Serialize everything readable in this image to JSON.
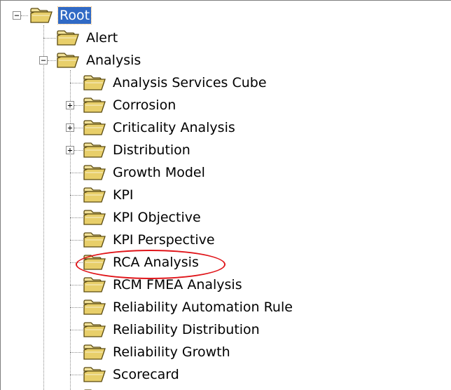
{
  "tree": {
    "nodes": [
      {
        "label": "Root",
        "state": "expanded",
        "selected": true
      },
      {
        "label": "Alert"
      },
      {
        "label": "Analysis",
        "state": "expanded"
      },
      {
        "label": "Analysis Services Cube"
      },
      {
        "label": "Corrosion",
        "state": "collapsed"
      },
      {
        "label": "Criticality Analysis",
        "state": "collapsed"
      },
      {
        "label": "Distribution",
        "state": "collapsed"
      },
      {
        "label": "Growth Model"
      },
      {
        "label": "KPI"
      },
      {
        "label": "KPI Objective"
      },
      {
        "label": "KPI Perspective"
      },
      {
        "label": "RCA Analysis",
        "highlighted": true
      },
      {
        "label": "RCM FMEA Analysis"
      },
      {
        "label": "Reliability Automation Rule"
      },
      {
        "label": "Reliability Distribution"
      },
      {
        "label": "Reliability Growth"
      },
      {
        "label": "Scorecard"
      }
    ],
    "expander_glyphs": {
      "expanded": "−",
      "collapsed": "+"
    },
    "icons": {
      "folder": "folder-icon"
    },
    "colors": {
      "selection": "#316ac5",
      "highlight_ring": "#e0151a",
      "folder_fill": "#f2e29a",
      "folder_edge": "#5a4a10"
    }
  }
}
